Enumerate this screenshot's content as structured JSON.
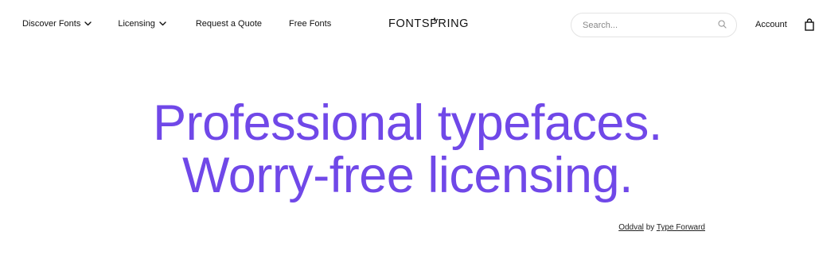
{
  "nav": {
    "discover_label": "Discover Fonts",
    "licensing_label": "Licensing",
    "quote_label": "Request a Quote",
    "free_label": "Free Fonts"
  },
  "logo": {
    "text": "FONTSPRING"
  },
  "search": {
    "placeholder": "Search..."
  },
  "account": {
    "label": "Account"
  },
  "hero": {
    "line1": "Professional typefaces.",
    "line2": "Worry-free licensing."
  },
  "credit": {
    "font_name": "Oddval",
    "by_text": "by",
    "foundry": "Type Forward"
  },
  "colors": {
    "accent": "#7048e8",
    "text": "#111111",
    "border": "#e3e3e3"
  },
  "icons": {
    "chevron": "chevron-down-icon",
    "search": "search-icon",
    "bag": "shopping-bag-icon",
    "sprout": "sprout-icon"
  }
}
